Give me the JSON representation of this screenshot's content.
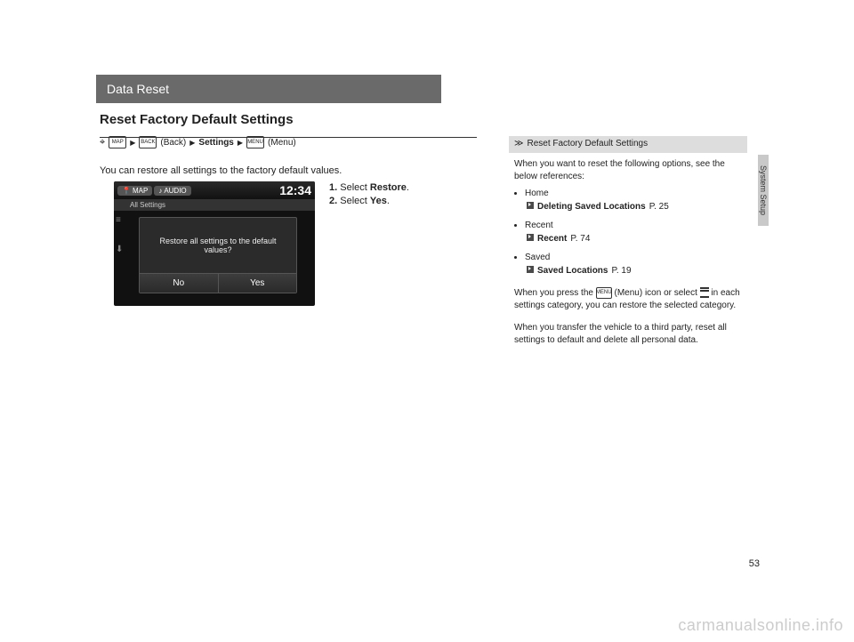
{
  "header": {
    "title": "Data Reset"
  },
  "section": {
    "title": "Reset Factory Default Settings"
  },
  "breadcrumb": {
    "map_label": "MAP",
    "back_icon_label": "BACK",
    "back_text": "(Back)",
    "settings_text": "Settings",
    "menu_icon_label": "MENU",
    "menu_text": "(Menu)"
  },
  "description": "You can restore all settings to the factory default values.",
  "infotainment": {
    "tab_map": "MAP",
    "tab_audio": "AUDIO",
    "clock": "12:34",
    "subheader": "All Settings",
    "dialog_message": "Restore all settings to the default values?",
    "btn_no": "No",
    "btn_yes": "Yes"
  },
  "steps": {
    "step1_num": "1.",
    "step1_verb": "Select ",
    "step1_target": "Restore",
    "step2_num": "2.",
    "step2_verb": "Select ",
    "step2_target": "Yes"
  },
  "tips": {
    "title": "Reset Factory Default Settings",
    "intro": "When you want to reset the following options, see the below references:",
    "items": [
      {
        "label": "Home",
        "ref": "Deleting Saved Locations",
        "page": "P. 25"
      },
      {
        "label": "Recent",
        "ref": "Recent",
        "page": "P. 74"
      },
      {
        "label": "Saved",
        "ref": "Saved Locations",
        "page": "P. 19"
      }
    ],
    "para2a": "When you press the ",
    "para2b": " (Menu) icon or select ",
    "para2c": " in each settings category, you can restore the selected category.",
    "para3": "When you transfer the vehicle to a third party, reset all settings to default and delete all personal data."
  },
  "side_tab": "System Setup",
  "page_number": "53",
  "watermark": "carmanualsonline.info"
}
